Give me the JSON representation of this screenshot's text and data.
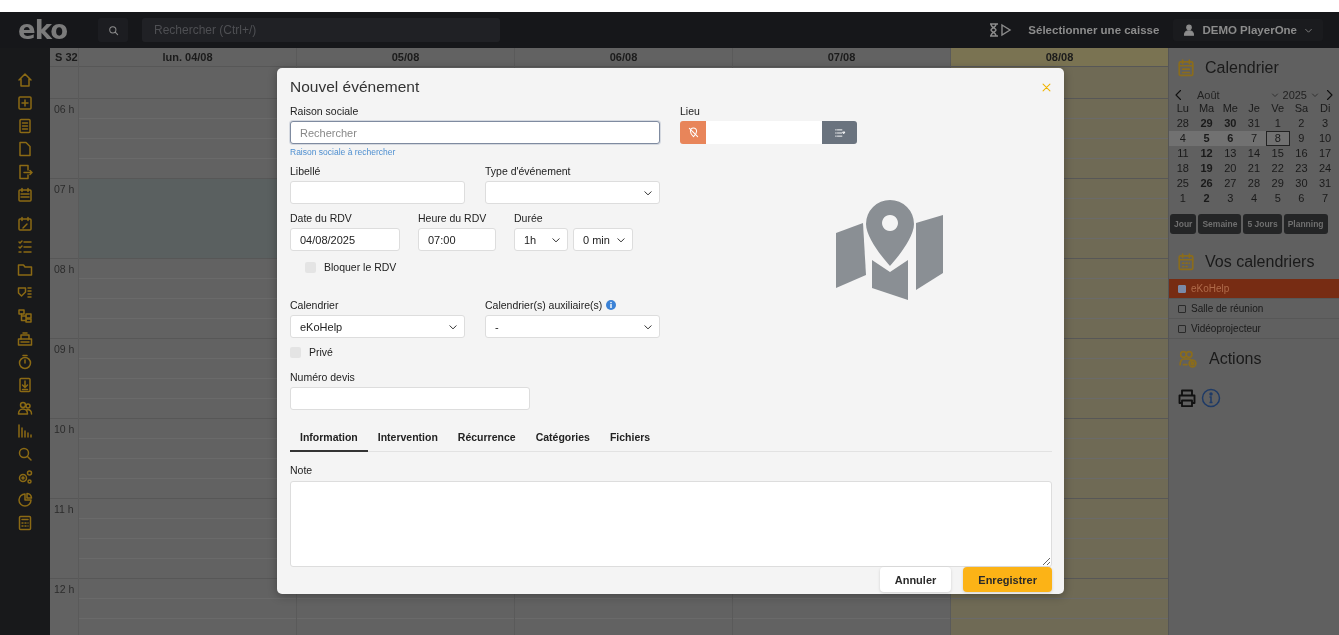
{
  "topbar": {
    "logo": "eko",
    "search_placeholder": "Rechercher (Ctrl+/)",
    "cash_register": "Sélectionner une caisse",
    "user": "DEMO PlayerOne"
  },
  "calendar": {
    "week": "S 32",
    "hours": [
      "06 h",
      "07 h",
      "08 h",
      "09 h",
      "10 h",
      "11 h",
      "12 h"
    ],
    "days": [
      {
        "label": "lun. 04/08",
        "today": false,
        "slot_selected": true
      },
      {
        "label": "05/08",
        "today": false
      },
      {
        "label": "06/08",
        "today": false
      },
      {
        "label": "07/08",
        "today": false
      },
      {
        "label": "08/08",
        "today": true,
        "slot_selected": false
      }
    ]
  },
  "right_panel": {
    "title": "Calendrier",
    "month": "Août",
    "year": "2025",
    "weekdays": [
      "Lu",
      "Ma",
      "Me",
      "Je",
      "Ve",
      "Sa",
      "Di"
    ],
    "weeks": [
      {
        "selected": false,
        "days": [
          {
            "day": "28",
            "bold": false,
            "today": false
          },
          {
            "day": "29",
            "bold": true,
            "today": false
          },
          {
            "day": "30",
            "bold": true,
            "today": false
          },
          {
            "day": "31",
            "bold": false,
            "today": false
          },
          {
            "day": "1",
            "bold": false,
            "today": false
          },
          {
            "day": "2",
            "bold": false,
            "today": false
          },
          {
            "day": "3",
            "bold": false,
            "today": false
          }
        ]
      },
      {
        "selected": true,
        "days": [
          {
            "day": "4",
            "bold": false,
            "today": false
          },
          {
            "day": "5",
            "bold": true,
            "today": false
          },
          {
            "day": "6",
            "bold": true,
            "today": false
          },
          {
            "day": "7",
            "bold": false,
            "today": false
          },
          {
            "day": "8",
            "bold": false,
            "today": true
          },
          {
            "day": "9",
            "bold": false,
            "today": false
          },
          {
            "day": "10",
            "bold": false,
            "today": false
          }
        ]
      },
      {
        "selected": false,
        "days": [
          {
            "day": "11",
            "bold": false,
            "today": false
          },
          {
            "day": "12",
            "bold": true,
            "today": false
          },
          {
            "day": "13",
            "bold": false,
            "today": false
          },
          {
            "day": "14",
            "bold": false,
            "today": false
          },
          {
            "day": "15",
            "bold": false,
            "today": false
          },
          {
            "day": "16",
            "bold": false,
            "today": false
          },
          {
            "day": "17",
            "bold": false,
            "today": false
          }
        ]
      },
      {
        "selected": false,
        "days": [
          {
            "day": "18",
            "bold": false,
            "today": false
          },
          {
            "day": "19",
            "bold": true,
            "today": false
          },
          {
            "day": "20",
            "bold": false,
            "today": false
          },
          {
            "day": "21",
            "bold": false,
            "today": false
          },
          {
            "day": "22",
            "bold": false,
            "today": false
          },
          {
            "day": "23",
            "bold": false,
            "today": false
          },
          {
            "day": "24",
            "bold": false,
            "today": false
          }
        ]
      },
      {
        "selected": false,
        "days": [
          {
            "day": "25",
            "bold": false,
            "today": false
          },
          {
            "day": "26",
            "bold": true,
            "today": false
          },
          {
            "day": "27",
            "bold": false,
            "today": false
          },
          {
            "day": "28",
            "bold": false,
            "today": false
          },
          {
            "day": "29",
            "bold": false,
            "today": false
          },
          {
            "day": "30",
            "bold": false,
            "today": false
          },
          {
            "day": "31",
            "bold": false,
            "today": false
          }
        ]
      },
      {
        "selected": false,
        "days": [
          {
            "day": "1",
            "bold": false,
            "today": false
          },
          {
            "day": "2",
            "bold": true,
            "today": false
          },
          {
            "day": "3",
            "bold": false,
            "today": false
          },
          {
            "day": "4",
            "bold": false,
            "today": false
          },
          {
            "day": "5",
            "bold": false,
            "today": false
          },
          {
            "day": "6",
            "bold": false,
            "today": false
          },
          {
            "day": "7",
            "bold": false,
            "today": false
          }
        ]
      }
    ],
    "views": [
      "Jour",
      "Semaine",
      "5 Jours",
      "Planning"
    ],
    "calendars_title": "Vos calendriers",
    "calendars": [
      {
        "label": "eKoHelp",
        "checked": true
      },
      {
        "label": "Salle de réunion",
        "checked": false
      },
      {
        "label": "Vidéoprojecteur",
        "checked": false
      }
    ],
    "actions_title": "Actions"
  },
  "modal": {
    "title": "Nouvel événement",
    "raison_sociale": {
      "label": "Raison sociale",
      "placeholder": "Rechercher",
      "hint": "Raison sociale à rechercher"
    },
    "lieu": {
      "label": "Lieu"
    },
    "libelle": {
      "label": "Libellé"
    },
    "type_evenement": {
      "label": "Type d'événement"
    },
    "date": {
      "label": "Date du RDV",
      "value": "04/08/2025"
    },
    "heure": {
      "label": "Heure du RDV",
      "value": "07:00"
    },
    "duree": {
      "label": "Durée",
      "hours": "1h",
      "minutes": "0 min"
    },
    "bloquer": {
      "label": "Bloquer le RDV",
      "checked": false
    },
    "calendrier": {
      "label": "Calendrier",
      "value": "eKoHelp"
    },
    "auxiliaires": {
      "label": "Calendrier(s) auxiliaire(s)",
      "value": "-"
    },
    "prive": {
      "label": "Privé",
      "checked": false
    },
    "numero_devis": {
      "label": "Numéro devis"
    },
    "tabs": [
      {
        "label": "Information",
        "selected": true
      },
      {
        "label": "Intervention",
        "selected": false
      },
      {
        "label": "Récurrence",
        "selected": false
      },
      {
        "label": "Catégories",
        "selected": false
      },
      {
        "label": "Fichiers",
        "selected": false
      }
    ],
    "note": {
      "label": "Note"
    },
    "buttons": [
      {
        "label": "Annuler",
        "kind": "secondary"
      },
      {
        "label": "Enregistrer",
        "kind": "primary"
      }
    ]
  }
}
